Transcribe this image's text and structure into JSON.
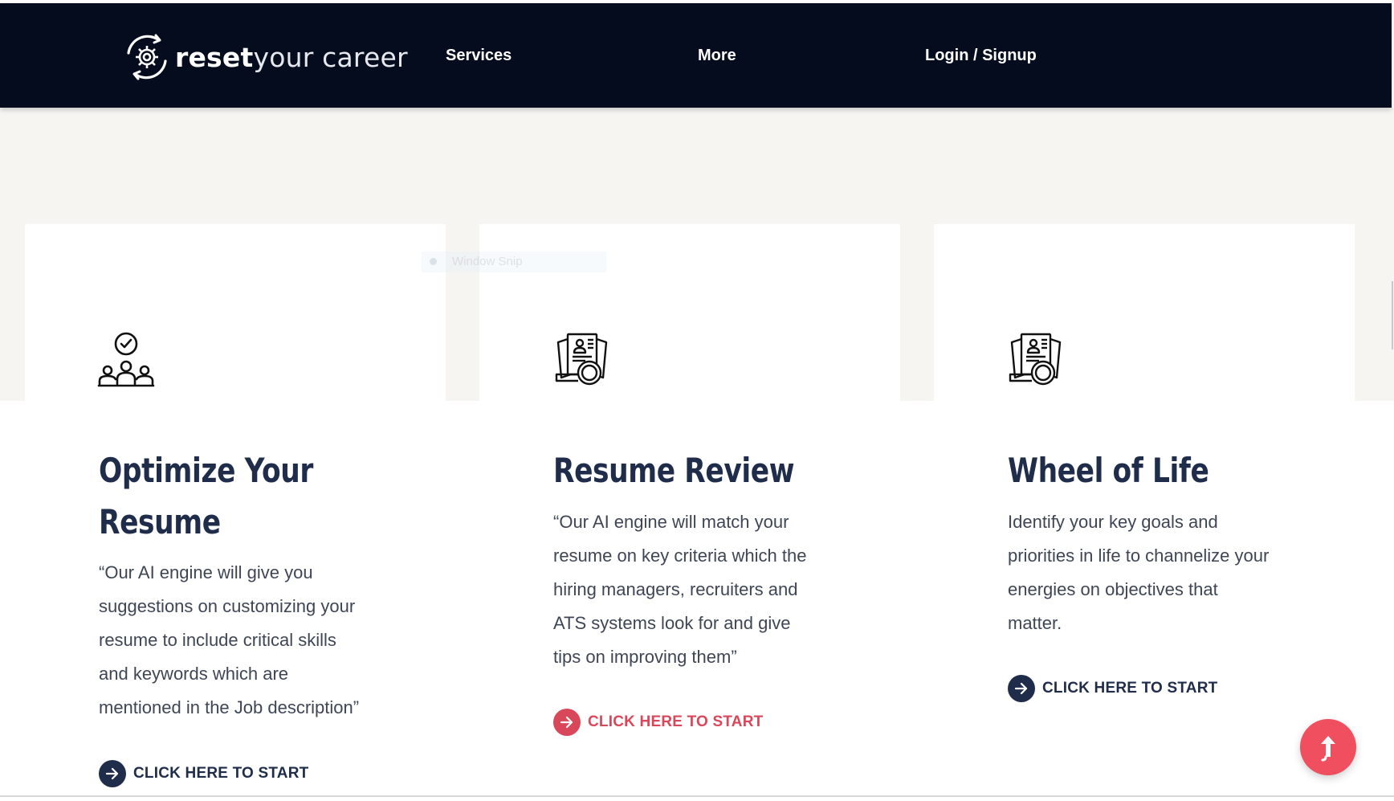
{
  "brand": {
    "logo_bold": "reset",
    "logo_rest": "your career"
  },
  "nav": {
    "services": "Services",
    "more": "More",
    "login": "Login / Signup"
  },
  "overlay": {
    "snip_label": "Window Snip"
  },
  "cards": [
    {
      "icon": "team-check-icon",
      "title_line1": "Optimize Your",
      "title_line2": "Resume",
      "desc_lines": [
        "“Our AI engine will give you",
        "suggestions on customizing your",
        "resume to include critical skills",
        "and keywords which are",
        "mentioned in the Job description”"
      ],
      "cta": "CLICK HERE TO START",
      "cta_color": "#1f2d4b"
    },
    {
      "icon": "resume-search-icon",
      "title_line1": "Resume Review",
      "desc_lines": [
        "“Our AI engine will match your",
        "resume on key criteria which the",
        "hiring managers, recruiters and",
        "ATS systems look for and give",
        "tips on improving them”"
      ],
      "cta": "CLICK HERE TO START",
      "cta_color": "#d9475a"
    },
    {
      "icon": "resume-search-icon",
      "title_line1": "Wheel of Life",
      "desc_lines": [
        "Identify your key goals and",
        "priorities in life to channelize your",
        "energies on objectives that",
        "matter."
      ],
      "cta": "CLICK HERE TO START",
      "cta_color": "#1f2d4b"
    }
  ],
  "colors": {
    "nav_bg": "#040c1e",
    "title": "#1f2d4b",
    "accent": "#d9475a",
    "scroll_button": "#ef4f5f"
  },
  "scroll_top_icon": "arrow-up-icon"
}
